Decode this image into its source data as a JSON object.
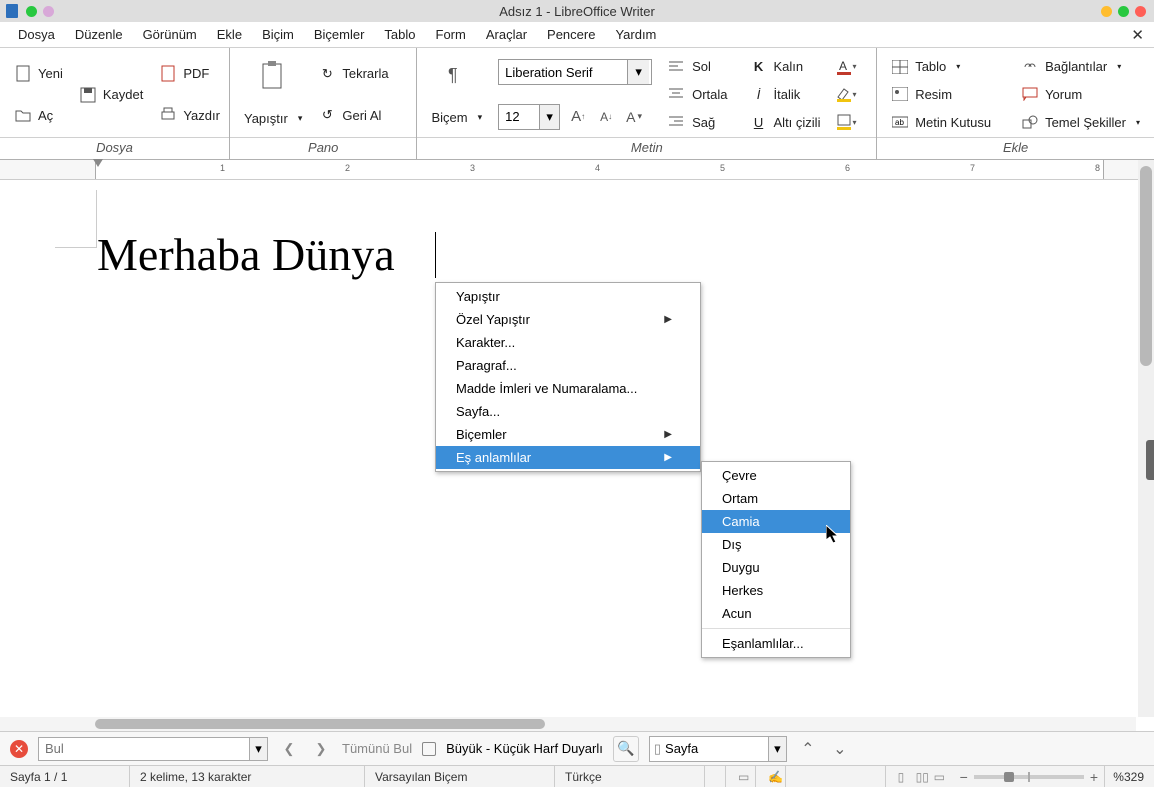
{
  "titlebar": {
    "title": "Adsız 1 - LibreOffice Writer"
  },
  "menubar": {
    "items": [
      "Dosya",
      "Düzenle",
      "Görünüm",
      "Ekle",
      "Biçim",
      "Biçemler",
      "Tablo",
      "Form",
      "Araçlar",
      "Pencere",
      "Yardım"
    ]
  },
  "ribbon": {
    "groups": {
      "file": {
        "label": "Dosya",
        "new": "Yeni",
        "pdf": "PDF",
        "open": "Aç",
        "save": "Kaydet",
        "print": "Yazdır"
      },
      "clip": {
        "label": "Pano",
        "paste": "Yapıştır",
        "redo": "Tekrarla",
        "undo": "Geri Al"
      },
      "text": {
        "label": "Metin",
        "style": "Biçem",
        "font": "Liberation Serif",
        "size": "12",
        "align_left": "Sol",
        "align_center": "Ortala",
        "align_right": "Sağ",
        "bold": "Kalın",
        "italic": "İtalik",
        "underline": "Altı çizili"
      },
      "insert": {
        "label": "Ekle",
        "table": "Tablo",
        "image": "Resim",
        "textbox": "Metin Kutusu",
        "links": "Bağlantılar",
        "comment": "Yorum",
        "shapes": "Temel Şekiller"
      }
    }
  },
  "document": {
    "text": "Merhaba Dünya"
  },
  "context_menu": {
    "items": [
      {
        "label": "Yapıştır"
      },
      {
        "label": "Özel Yapıştır",
        "submenu": true
      },
      {
        "label": "Karakter..."
      },
      {
        "label": "Paragraf..."
      },
      {
        "label": "Madde İmleri ve Numaralama..."
      },
      {
        "label": "Sayfa..."
      },
      {
        "label": "Biçemler",
        "submenu": true
      },
      {
        "label": "Eş anlamlılar",
        "submenu": true,
        "highlighted": true
      }
    ]
  },
  "submenu": {
    "items": [
      "Çevre",
      "Ortam",
      "Camia",
      "Dış",
      "Duygu",
      "Herkes",
      "Acun"
    ],
    "highlighted_index": 2,
    "footer": "Eşanlamlılar..."
  },
  "findbar": {
    "placeholder": "Bul",
    "find_all": "Tümünü Bul",
    "case": "Büyük - Küçük Harf Duyarlı",
    "page_combo": "Sayfa"
  },
  "statusbar": {
    "page": "Sayfa 1 / 1",
    "words": "2 kelime, 13 karakter",
    "style": "Varsayılan Biçem",
    "lang": "Türkçe",
    "zoom": "%329"
  }
}
